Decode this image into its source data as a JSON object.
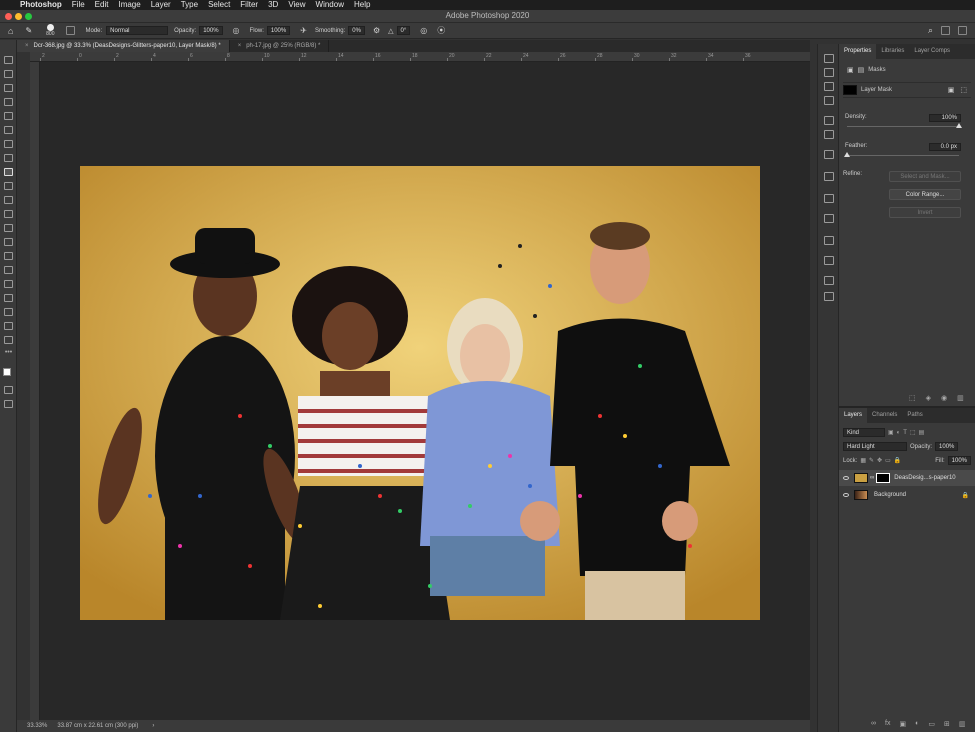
{
  "menubar": {
    "app": "Photoshop",
    "items": [
      "File",
      "Edit",
      "Image",
      "Layer",
      "Type",
      "Select",
      "Filter",
      "3D",
      "View",
      "Window",
      "Help"
    ]
  },
  "window": {
    "title": "Adobe Photoshop 2020"
  },
  "options": {
    "brush_size": "800",
    "mode_label": "Mode:",
    "mode_value": "Normal",
    "opacity_label": "Opacity:",
    "opacity_value": "100%",
    "flow_label": "Flow:",
    "flow_value": "100%",
    "smoothing_label": "Smoothing:",
    "smoothing_value": "0%",
    "angle_value": "0°"
  },
  "tabs": [
    {
      "label": "Dcr-368.jpg @ 33.3% (DeasDesigns-Glitters-paper10, Layer Mask/8) *"
    },
    {
      "label": "ph-17.jpg @ 25% (RGB/8) *"
    }
  ],
  "ruler": {
    "h_ticks": [
      "2",
      "0",
      "2",
      "4",
      "6",
      "8",
      "10",
      "12",
      "14",
      "16",
      "18",
      "20",
      "22",
      "24",
      "26",
      "28",
      "30",
      "32",
      "34",
      "36"
    ]
  },
  "status": {
    "zoom": "33.33%",
    "doc_size": "33.87 cm x 22.61 cm (300 ppi)"
  },
  "properties": {
    "tabs": [
      "Properties",
      "Libraries",
      "Layer Comps"
    ],
    "section_title": "Masks",
    "mask_type": "Layer Mask",
    "density_label": "Density:",
    "density_value": "100%",
    "density_level": 1.0,
    "feather_label": "Feather:",
    "feather_value": "0.0 px",
    "feather_level": 0.0,
    "refine_label": "Refine:",
    "select_mask_button": "Select and Mask...",
    "color_range_button": "Color Range...",
    "invert_button": "Invert"
  },
  "layers": {
    "tabs": [
      "Layers",
      "Channels",
      "Paths"
    ],
    "filter_kind": "Kind",
    "blend_mode": "Hard Light",
    "opacity_label": "Opacity:",
    "opacity_value": "100%",
    "lock_label": "Lock:",
    "fill_label": "Fill:",
    "fill_value": "100%",
    "rows": [
      {
        "name": "DeasDesig...s-paper10"
      },
      {
        "name": "Background"
      }
    ]
  },
  "colors": {
    "accent": "#1473e6",
    "canvas": "#282828",
    "panel": "#3a3a3a"
  }
}
